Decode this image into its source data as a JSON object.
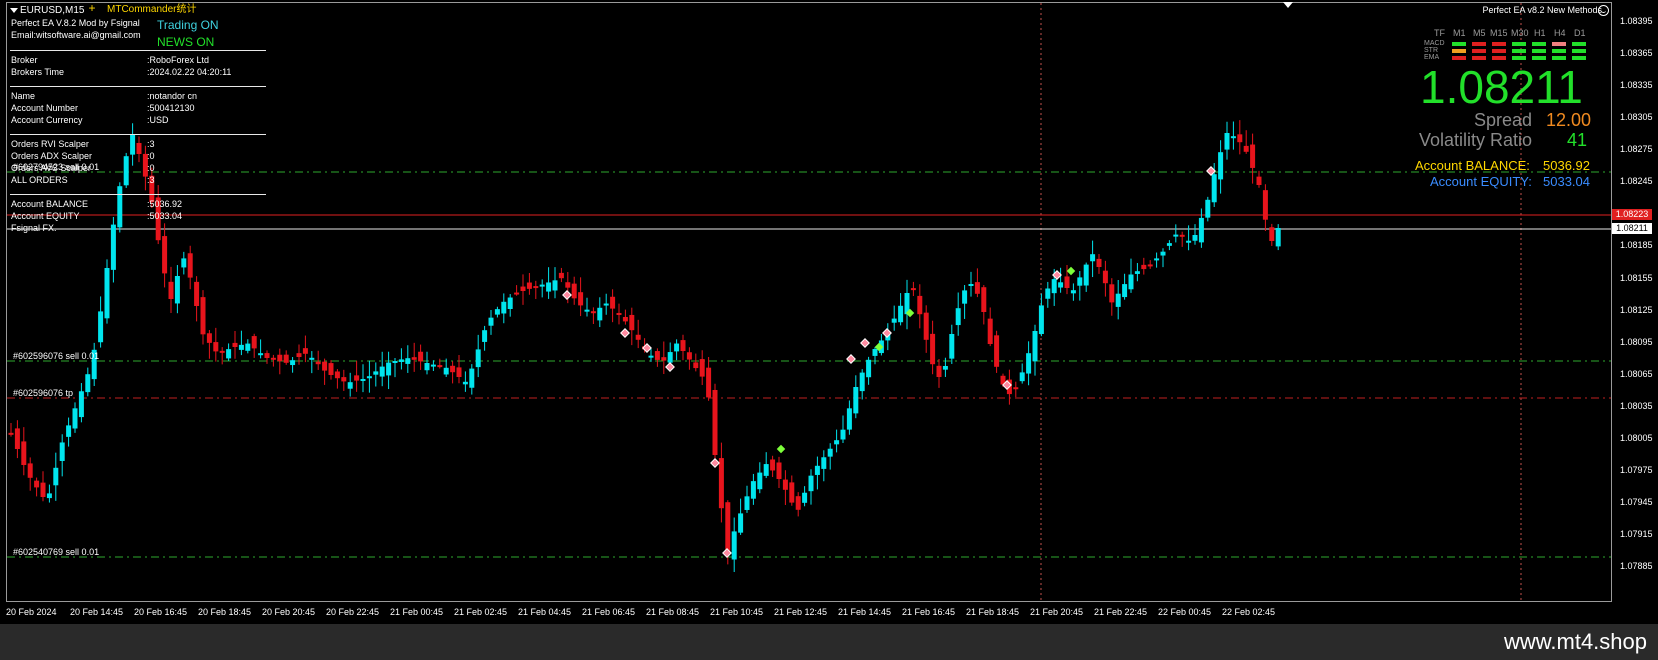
{
  "header": {
    "symbol": "EURUSD,M15",
    "plugin_label": "MTCommander统计",
    "ea_title": "Perfect EA V.8.2 Mod by Fsignal",
    "ea_email": "Email:witsoftware.ai@gmail.com",
    "trading_status": "Trading ON",
    "news_status": "NEWS ON"
  },
  "info_panel": {
    "rows": [
      {
        "label": "Broker",
        "value": ":RoboForex Ltd"
      },
      {
        "label": "Brokers Time",
        "value": ":2024.02.22 04:20:11"
      },
      {
        "label": "Name",
        "value": ":notandor cn"
      },
      {
        "label": "Account Number",
        "value": ":500412130"
      },
      {
        "label": "Account Currency",
        "value": ":USD"
      },
      {
        "label": "Orders RVI Scalper",
        "value": ":3"
      },
      {
        "label": "Orders ADX Scalper",
        "value": ":0"
      },
      {
        "label": "Orders AVS Scalper",
        "value": ":0"
      },
      {
        "label": "ALL ORDERS",
        "value": ":3"
      },
      {
        "label": "Account BALANCE",
        "value": ":5036.92"
      },
      {
        "label": "Account EQUITY",
        "value": ":5033.04"
      }
    ],
    "footer_note": "Fsignal FX."
  },
  "orders": {
    "order_top": "#602794523 sell 0.01",
    "order_mid": "#602596076 sell 0.01",
    "order_tp": "#602596076 tp",
    "order_low": "#602540769 sell 0.01"
  },
  "dashboard": {
    "title": "Perfect EA v8.2 New Methods",
    "tf_label": "TF",
    "timeframes": [
      "M1",
      "M5",
      "M15",
      "M30",
      "H1",
      "H4",
      "D1"
    ],
    "rows": [
      "MACD",
      "STR",
      "EMA"
    ],
    "signals": [
      [
        "#22e02a",
        "#e02020",
        "#e02020",
        "#22e02a",
        "#22e02a",
        "#f08080",
        "#22e02a"
      ],
      [
        "#f0a020",
        "#e02020",
        "#e02020",
        "#22e02a",
        "#22e02a",
        "#22e02a",
        "#22e02a"
      ],
      [
        "#e02020",
        "#e02020",
        "#e02020",
        "#22e02a",
        "#22e02a",
        "#22e02a",
        "#22e02a"
      ]
    ],
    "price": "1.08211",
    "spread_label": "Spread",
    "spread_value": "12.00",
    "volatility_label": "Volatility Ratio",
    "volatility_value": "41",
    "balance_label": "Account BALANCE:",
    "balance_value": "5036.92",
    "equity_label": "Account EQUITY:",
    "equity_value": "5033.04"
  },
  "axis": {
    "prices": [
      "1.08395",
      "1.08365",
      "1.08335",
      "1.08305",
      "1.08275",
      "1.08245",
      "1.08185",
      "1.08155",
      "1.08125",
      "1.08095",
      "1.08065",
      "1.08035",
      "1.08005",
      "1.07975",
      "1.07945",
      "1.07915",
      "1.07885"
    ],
    "ask_tag": "1.08223",
    "bid_tag": "1.08211",
    "times": [
      "20 Feb 2024",
      "20 Feb 14:45",
      "20 Feb 16:45",
      "20 Feb 18:45",
      "20 Feb 20:45",
      "20 Feb 22:45",
      "21 Feb 00:45",
      "21 Feb 02:45",
      "21 Feb 04:45",
      "21 Feb 06:45",
      "21 Feb 08:45",
      "21 Feb 10:45",
      "21 Feb 12:45",
      "21 Feb 14:45",
      "21 Feb 16:45",
      "21 Feb 18:45",
      "21 Feb 20:45",
      "21 Feb 22:45",
      "22 Feb 00:45",
      "22 Feb 02:45"
    ]
  },
  "colors": {
    "bull": "#00e5ee",
    "bear": "#e8141c",
    "order_line": "#2ea82e",
    "tp_line": "#c02020",
    "ask_line": "#e02020",
    "bid_line": "#e8e8e8"
  },
  "footer": {
    "site": "www.mt4.shop"
  }
}
